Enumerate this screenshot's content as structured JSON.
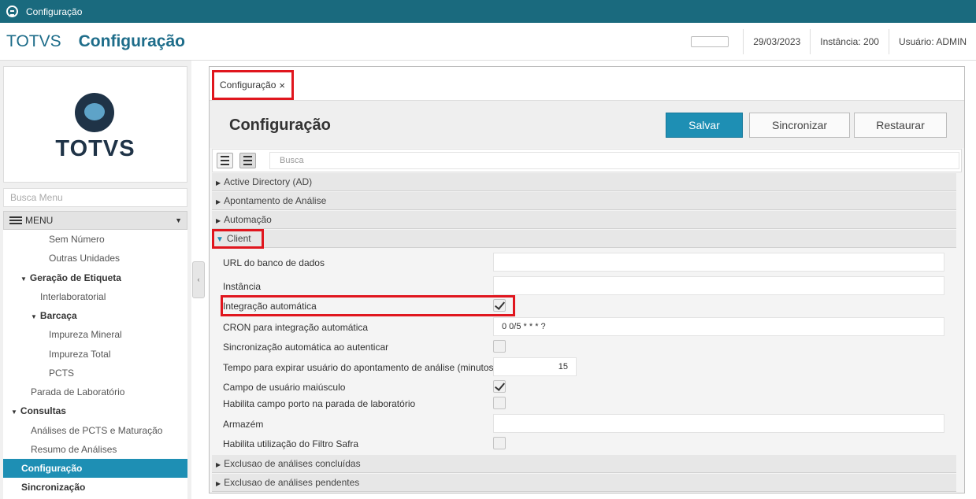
{
  "window": {
    "title": "Configuração"
  },
  "header": {
    "brand": "TOTVS",
    "page_title": "Configuração",
    "date": "29/03/2023",
    "instance": "Instância: 200",
    "user": "Usuário: ADMIN"
  },
  "logo": {
    "text": "TOTVS"
  },
  "menu": {
    "search_placeholder": "Busca Menu",
    "title": "MENU",
    "items": [
      {
        "label": "Sem Número"
      },
      {
        "label": "Outras Unidades"
      },
      {
        "label": "Geração de Etiqueta"
      },
      {
        "label": "Interlaboratorial"
      },
      {
        "label": "Barcaça"
      },
      {
        "label": "Impureza Mineral"
      },
      {
        "label": "Impureza Total"
      },
      {
        "label": "PCTS"
      },
      {
        "label": "Parada de Laboratório"
      },
      {
        "label": "Consultas"
      },
      {
        "label": "Análises de PCTS e Maturação"
      },
      {
        "label": "Resumo de Análises"
      },
      {
        "label": "Configuração"
      },
      {
        "label": "Sincronização"
      }
    ]
  },
  "tab": {
    "label": "Configuração",
    "close": "×"
  },
  "page": {
    "heading": "Configuração",
    "buttons": {
      "save": "Salvar",
      "sync": "Sincronizar",
      "restore": "Restaurar"
    },
    "search_placeholder": "Busca"
  },
  "sections": {
    "ad": "Active Directory (AD)",
    "apontamento": "Apontamento de Análise",
    "automacao": "Automação",
    "client": "Client",
    "exclusao_concluidas": "Exclusao de análises concluídas",
    "exclusao_pendentes": "Exclusao de análises pendentes"
  },
  "client": {
    "url_label": "URL do banco de dados",
    "instancia_label": "Instância",
    "integracao_label": "Integração automática",
    "integracao_checked": true,
    "cron_label": "CRON para integração automática",
    "cron_value": "0 0/5 * * * ?",
    "sync_label": "Sincronização automática ao autenticar",
    "sync_checked": false,
    "tempo_label": "Tempo para expirar usuário do apontamento de análise (minutos)",
    "tempo_value": "15",
    "campo_maiusculo_label": "Campo de usuário maiúsculo",
    "campo_maiusculo_checked": true,
    "porto_label": "Habilita campo porto na parada de laboratório",
    "porto_checked": false,
    "armazem_label": "Armazém",
    "filtro_safra_label": "Habilita utilização do Filtro Safra",
    "filtro_safra_checked": false
  },
  "icons": {
    "app": "app-logo-icon",
    "hamburger": "hamburger-icon",
    "collapse": "chevron-left-icon",
    "expand_triangle": "triangle-right-icon",
    "collapse_triangle": "triangle-down-icon"
  },
  "colors": {
    "titlebar": "#1a6a7e",
    "accent": "#1e8fb4",
    "highlight_box": "#e0161e"
  }
}
